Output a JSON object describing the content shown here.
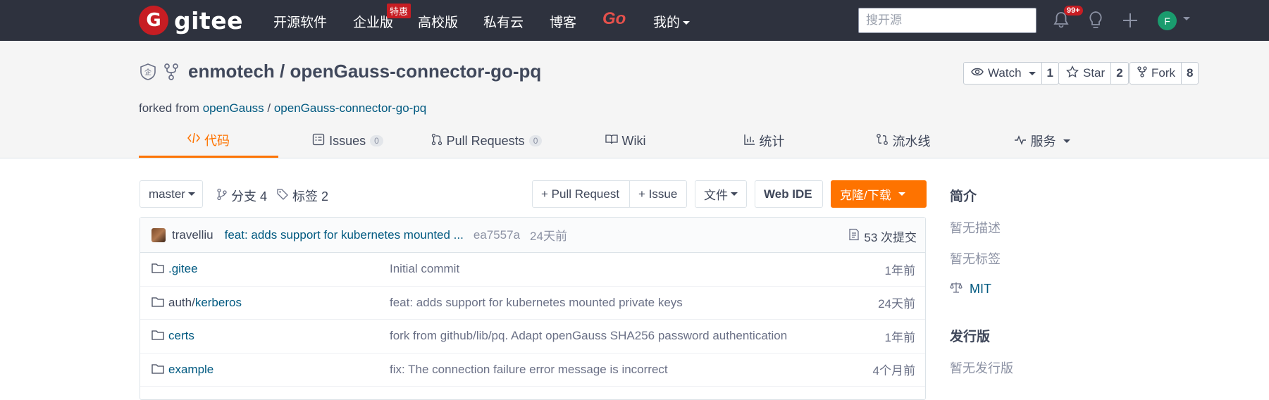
{
  "nav": {
    "logo_letter": "G",
    "logo_text": "gitee",
    "items": [
      "开源软件",
      "企业版",
      "高校版",
      "私有云",
      "博客",
      "Go",
      "我的"
    ],
    "enterprise_badge": "特惠",
    "search_placeholder": "搜开源",
    "notif_count": "99+",
    "avatar_letter": "F"
  },
  "repo": {
    "owner": "enmotech",
    "sep": " / ",
    "name": "openGauss-connector-go-pq",
    "forked_prefix": "forked from ",
    "forked_owner": "openGauss",
    "forked_sep": " / ",
    "forked_repo": "openGauss-connector-go-pq",
    "watch_label": "Watch",
    "watch_count": "1",
    "star_label": "Star",
    "star_count": "2",
    "fork_label": "Fork",
    "fork_count": "8"
  },
  "tabs": [
    {
      "label": "代码",
      "icon": "code-icon"
    },
    {
      "label": "Issues",
      "count": "0",
      "icon": "issues-icon"
    },
    {
      "label": "Pull Requests",
      "count": "0",
      "icon": "pull-request-icon"
    },
    {
      "label": "Wiki",
      "icon": "book-icon"
    },
    {
      "label": "统计",
      "icon": "bar-chart-icon"
    },
    {
      "label": "流水线",
      "icon": "pipeline-icon"
    },
    {
      "label": "服务",
      "icon": "pulse-icon"
    }
  ],
  "toolbar": {
    "branch": "master",
    "branches": "分支 4",
    "tags": "标签 2",
    "pull_request": "+ Pull Request",
    "issue": "+ Issue",
    "files": "文件",
    "web_ide": "Web IDE",
    "clone": "克隆/下载"
  },
  "last_commit": {
    "author": "travelliu",
    "message": "feat: adds support for kubernetes mounted ...",
    "hash": "ea7557a",
    "time": "24天前",
    "count": "53 次提交"
  },
  "files": [
    {
      "name": ".gitee",
      "message": "Initial commit",
      "time": "1年前"
    },
    {
      "prefix": "auth/",
      "name": "kerberos",
      "message": "feat: adds support for kubernetes mounted private keys",
      "time": "24天前"
    },
    {
      "name": "certs",
      "message": "fork from github/lib/pq. Adapt openGauss SHA256 password authentication",
      "time": "1年前"
    },
    {
      "name": "example",
      "message": "fix: The connection failure error message is incorrect",
      "time": "4个月前"
    }
  ],
  "sidebar": {
    "intro_title": "简介",
    "no_desc": "暂无描述",
    "no_tags": "暂无标签",
    "license": "MIT",
    "release_title": "发行版",
    "no_release": "暂无发行版"
  },
  "colors": {
    "accent": "#fe7300",
    "nav_bg": "#2e323e",
    "link": "#005980",
    "brand": "#c71d23"
  }
}
